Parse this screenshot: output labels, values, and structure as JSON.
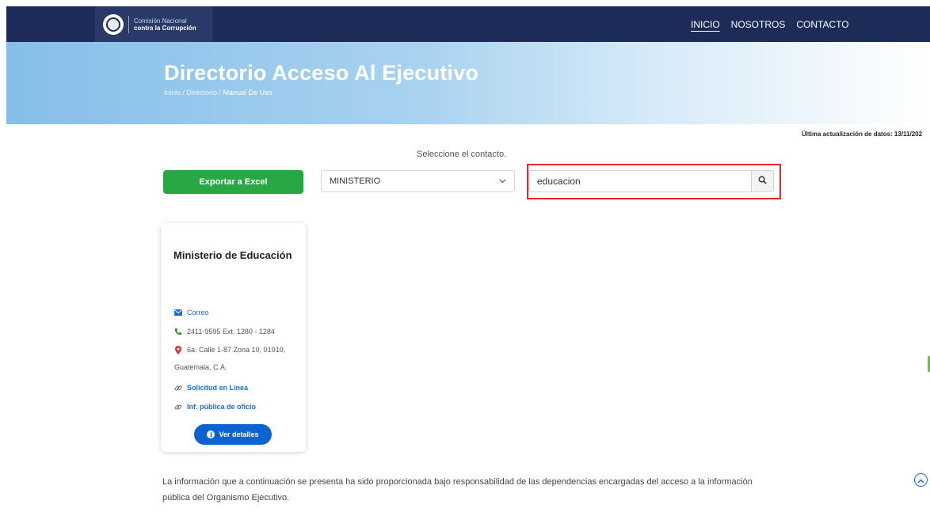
{
  "nav": {
    "logo_line1": "Comisión Nacional",
    "logo_line2": "contra la Corrupción",
    "links": [
      "INICIO",
      "NOSOTROS",
      "CONTACTO"
    ]
  },
  "hero": {
    "title": "Directorio Acceso Al Ejecutivo",
    "breadcrumb": [
      "Inicio",
      "Directorio",
      "Manual De Uso"
    ],
    "sep": " / "
  },
  "last_update": "Última actualización de datos: 13/11/202",
  "filters": {
    "prompt": "Seleccione el contacto.",
    "export_label": "Exportar a Excel",
    "select_value": "MINISTERIO",
    "search_value": "educacion"
  },
  "card": {
    "title": "Ministerio de Educación",
    "email_label": "Correo",
    "phone": "2411-9595 Ext. 1280 - 1284",
    "address_line1": "6a. Calle 1-87 Zona 10, 01010,",
    "address_line2": "Guatemala, C.A.",
    "link1": "Solicitud en Linea",
    "link2": "Inf. pública de oficio",
    "details_label": "Ver detalles"
  },
  "disclaimer": "La información que a continuación se presenta ha sido proporcionada bajo responsabilidad de las dependencias encargadas del acceso a la información pública del Organismo Ejecutivo.",
  "colors": {
    "nav_bg": "#1c2b57",
    "accent_green": "#28a745",
    "accent_blue": "#0a63d1",
    "highlight_red": "#e8262c"
  }
}
